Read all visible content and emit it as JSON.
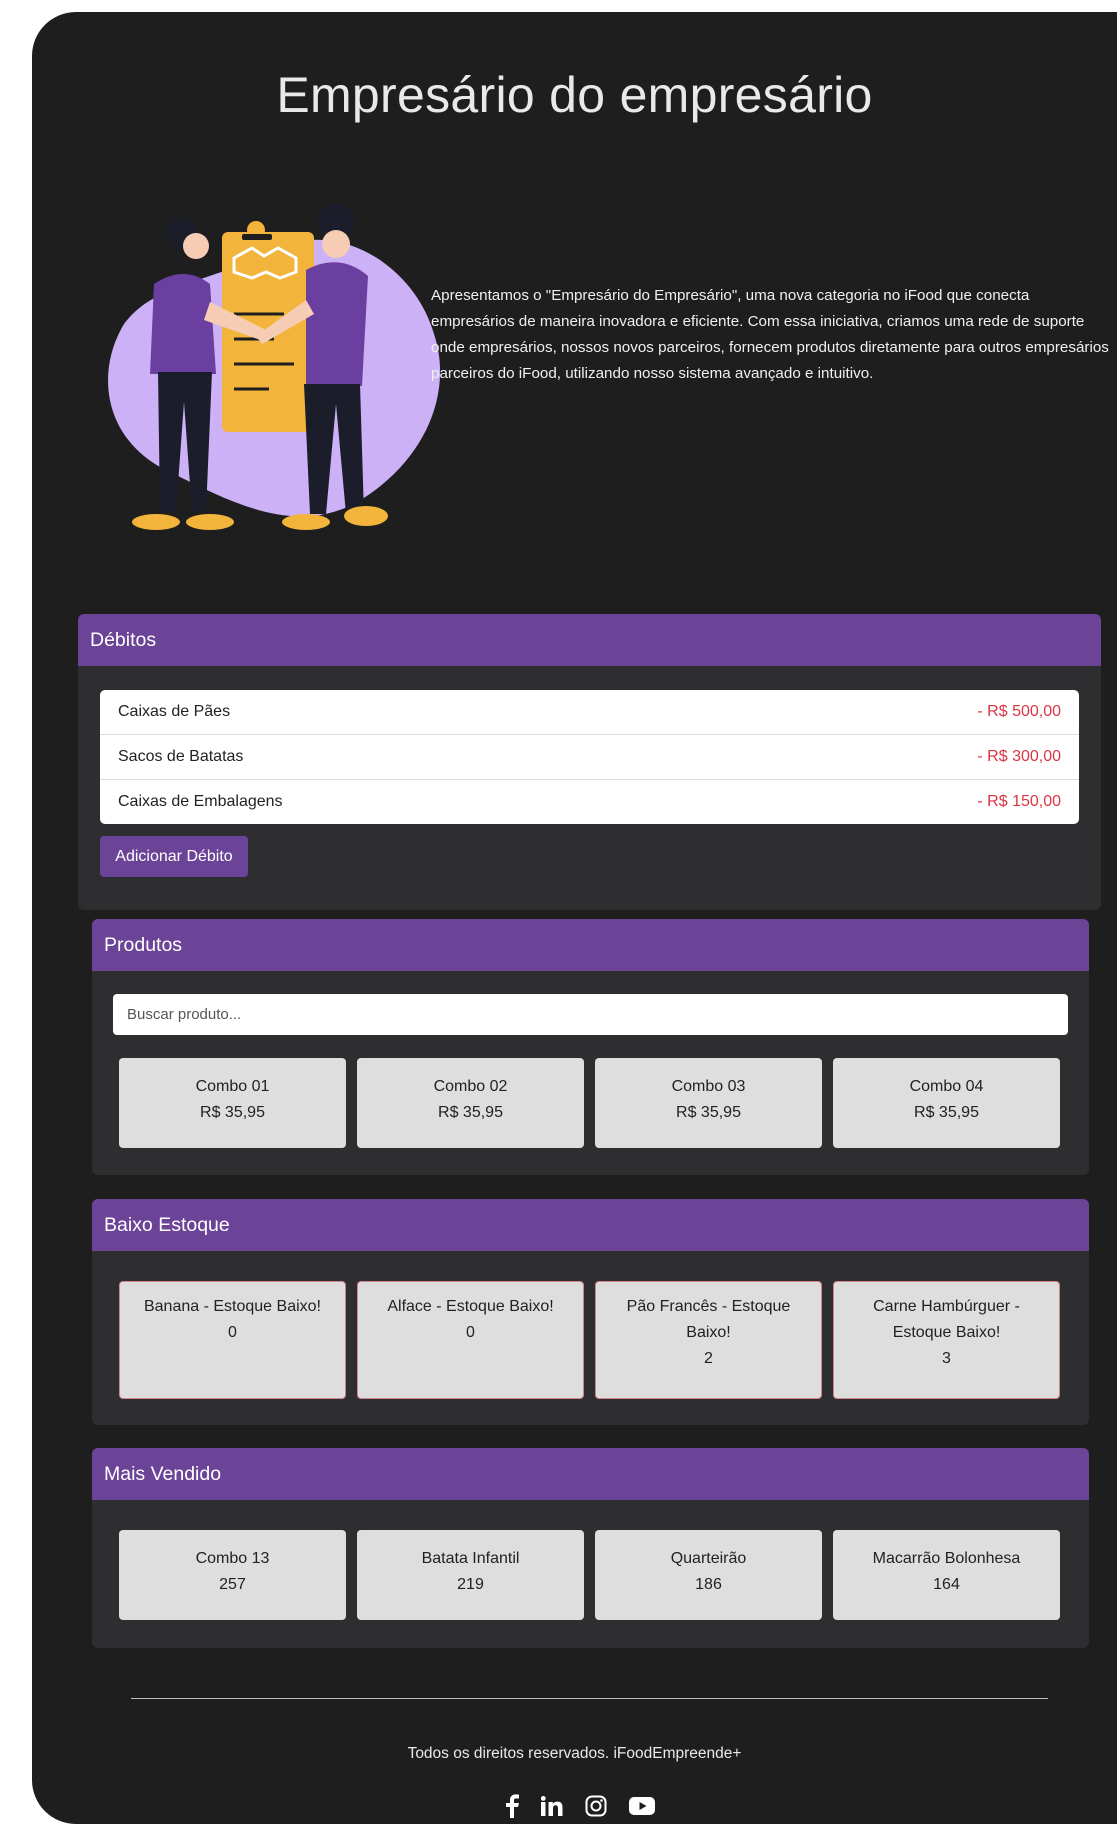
{
  "page_title": "Empresário do empresário",
  "hero": {
    "description": "Apresentamos o \"Empresário do Empresário\", uma nova categoria no iFood que conecta empresários de maneira inovadora e eficiente. Com essa iniciativa, criamos uma rede de suporte onde empresários, nossos novos parceiros, fornecem produtos diretamente para outros empresários parceiros do iFood, utilizando nosso sistema avançado e intuitivo."
  },
  "debits": {
    "title": "Débitos",
    "items": [
      {
        "name": "Caixas de Pães",
        "amount": "- R$ 500,00"
      },
      {
        "name": "Sacos de Batatas",
        "amount": "- R$ 300,00"
      },
      {
        "name": "Caixas de Embalagens",
        "amount": "- R$ 150,00"
      }
    ],
    "add_button": "Adicionar Débito"
  },
  "products": {
    "title": "Produtos",
    "search_placeholder": "Buscar produto...",
    "items": [
      {
        "name": "Combo 01",
        "price": "R$ 35,95"
      },
      {
        "name": "Combo 02",
        "price": "R$ 35,95"
      },
      {
        "name": "Combo 03",
        "price": "R$ 35,95"
      },
      {
        "name": "Combo 04",
        "price": "R$ 35,95"
      }
    ]
  },
  "low_stock": {
    "title": "Baixo Estoque",
    "items": [
      {
        "label": "Banana - Estoque Baixo!",
        "qty": "0"
      },
      {
        "label": "Alface - Estoque Baixo!",
        "qty": "0"
      },
      {
        "label": "Pão Francês - Estoque Baixo!",
        "qty": "2"
      },
      {
        "label": "Carne Hambúrguer - Estoque Baixo!",
        "qty": "3"
      }
    ]
  },
  "best_sellers": {
    "title": "Mais Vendido",
    "items": [
      {
        "name": "Combo 13",
        "count": "257"
      },
      {
        "name": "Batata Infantil",
        "count": "219"
      },
      {
        "name": "Quarteirão",
        "count": "186"
      },
      {
        "name": "Macarrão Bolonhesa",
        "count": "164"
      }
    ]
  },
  "footer": {
    "text": "Todos os direitos reservados. iFoodEmpreende+",
    "social_icons": [
      "facebook-icon",
      "linkedin-icon",
      "instagram-icon",
      "youtube-icon"
    ]
  },
  "colors": {
    "background": "#1e1e1f",
    "accent": "#6b4397",
    "section": "#2e2e30",
    "debit_amount": "#dc3545",
    "card": "#dedede"
  }
}
